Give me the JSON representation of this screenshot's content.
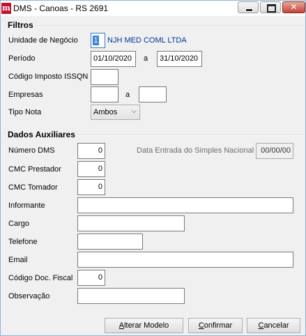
{
  "window": {
    "title": "DMS - Canoas - RS 2691",
    "app_icon_glyph": "m",
    "controls": {
      "minimize": "minimize-icon",
      "maximize": "maximize-icon",
      "close": "close-icon",
      "close_glyph": "✕"
    }
  },
  "filtros": {
    "group_title": "Filtros",
    "unidade_label": "Unidade de Negócio",
    "unidade_code": "1",
    "unidade_name": "NJH MED COML LTDA",
    "periodo_label": "Período",
    "periodo_start": "01/10/2020",
    "periodo_sep": "a",
    "periodo_end": "31/10/2020",
    "codigo_imposto_label": "Código Imposto ISSQN",
    "codigo_imposto_value": "",
    "empresas_label": "Empresas",
    "empresas_from": "",
    "empresas_sep": "a",
    "empresas_to": "",
    "tipo_nota_label": "Tipo Nota",
    "tipo_nota_value": "Ambos",
    "tipo_nota_chevron": "⌵"
  },
  "dados": {
    "group_title": "Dados Auxiliares",
    "numero_dms_label": "Número DMS",
    "numero_dms_value": "0",
    "data_entrada_label": "Data Entrada do Simples Nacional",
    "data_entrada_value": "00/00/00",
    "cmc_prestador_label": "CMC Prestador",
    "cmc_prestador_value": "0",
    "cmc_tomador_label": "CMC Tomador",
    "cmc_tomador_value": "0",
    "informante_label": "Informante",
    "informante_value": "",
    "cargo_label": "Cargo",
    "cargo_value": "",
    "telefone_label": "Telefone",
    "telefone_value": "",
    "email_label": "Email",
    "email_value": "",
    "codigo_doc_label": "Código Doc. Fiscal",
    "codigo_doc_value": "0",
    "observacao_label": "Observação",
    "observacao_value": ""
  },
  "buttons": {
    "alterar_accel": "A",
    "alterar_rest": "lterar Modelo",
    "confirmar_accel": "C",
    "confirmar_rest": "onfirmar",
    "cancelar_accel": "C",
    "cancelar_rest": "ancelar"
  }
}
